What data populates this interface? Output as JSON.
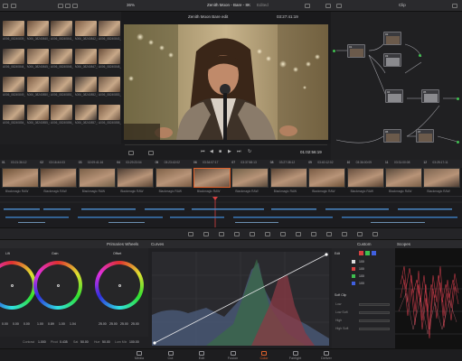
{
  "topbar": {
    "zoom": "36%",
    "project_title": "Zenith Moon - Bare - 8K",
    "edited": "Edited",
    "viewer_clip_name": "Zenith Moon Bare edit",
    "timecode": "03:27:41:19",
    "clip_menu": "Clip"
  },
  "media_pool": {
    "labels": [
      "A006_08240839_C...",
      "A006_08240840_C...",
      "A006_08240841_C...",
      "A006_08240842_C...",
      "A006_08240843_C...",
      "A006_08240844_C...",
      "A006_08240845_C...",
      "A006_08240846_C...",
      "A006_08240847_C...",
      "A006_08240848_C...",
      "A006_08240849_C...",
      "A006_08240850_C...",
      "A006_08240851_C...",
      "A006_08240852_C...",
      "A006_08240853_C...",
      "A006_08240854_C...",
      "A006_08240855_C...",
      "A006_08240856_C...",
      "A006_08240857_C...",
      "A006_08240858_C..."
    ]
  },
  "viewer": {
    "timecode": "01:02:56:19"
  },
  "clips": [
    {
      "num": "01",
      "tc": "03:21:36:12",
      "label": "Blackmagic RAW"
    },
    {
      "num": "02",
      "tc": "03:16:44:03",
      "label": "Blackmagic RAW"
    },
    {
      "num": "03",
      "tc": "02:09:41:16",
      "label": "Blackmagic RAW"
    },
    {
      "num": "04",
      "tc": "03:29:23:04",
      "label": "Blackmagic RAW"
    },
    {
      "num": "05",
      "tc": "03:23:42:02",
      "label": "Blackmagic RAW"
    },
    {
      "num": "06",
      "tc": "03:34:07:17",
      "label": "Blackmagic RAW"
    },
    {
      "num": "07",
      "tc": "03:37:58:13",
      "label": "Blackmagic RAW"
    },
    {
      "num": "08",
      "tc": "03:27:38:12",
      "label": "Blackmagic RAW"
    },
    {
      "num": "09",
      "tc": "03:40:12:02",
      "label": "Blackmagic RAW"
    },
    {
      "num": "10",
      "tc": "03:36:00:09",
      "label": "Blackmagic RAW"
    },
    {
      "num": "11",
      "tc": "03:31:00:08",
      "label": "Blackmagic RAW"
    },
    {
      "num": "12",
      "tc": "03:25:17:11",
      "label": "Blackmagic RAW"
    }
  ],
  "panels": {
    "primaries": "Primaries Wheels",
    "curves": "Curves",
    "custom": "Custom",
    "scopes": "Scopes",
    "edit": "Edit",
    "soft_clip": "Soft Clip",
    "wheels": [
      {
        "name": "Lift",
        "values": [
          "0.00",
          "0.00",
          "0.00",
          "0.00"
        ]
      },
      {
        "name": "Gain",
        "values": [
          "1.00",
          "0.89",
          "1.00",
          "1.04"
        ]
      },
      {
        "name": "Offset",
        "values": [
          "25.00",
          "25.00",
          "25.00",
          "25.00"
        ]
      }
    ],
    "footer": {
      "contrast_label": "Contrast",
      "contrast": "1.000",
      "pivot_label": "Pivot",
      "pivot": "0.435",
      "sat_label": "Sat",
      "sat": "50.00",
      "hue_label": "Hue",
      "hue": "50.00",
      "lummix_label": "Lum Mix",
      "lummix": "100.00"
    },
    "curve_values": [
      "100",
      "100",
      "100",
      "100"
    ],
    "soft_rows": [
      "Low",
      "Low Soft",
      "High",
      "High Soft"
    ]
  },
  "page_nav": [
    "Media",
    "Cut",
    "Edit",
    "Fusion",
    "Color",
    "Fairlight",
    "Deliver"
  ],
  "active_page": "Color",
  "colors": {
    "accent": "#e0612b",
    "red": "#d84040",
    "green": "#3fbf50",
    "blue": "#4060e0"
  }
}
